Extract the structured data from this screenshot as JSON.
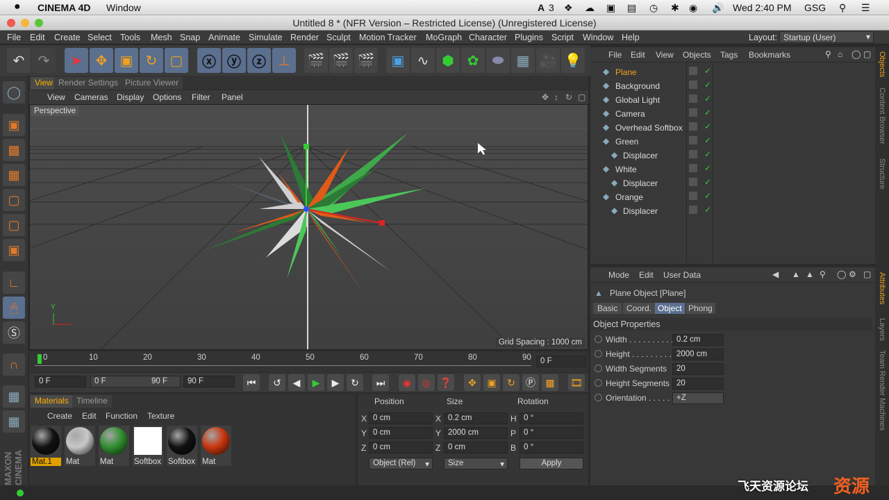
{
  "macbar": {
    "apple": "",
    "app": "CINEMA 4D",
    "window_menu": "Window",
    "adobe_count": "3",
    "clock": "Wed 2:40 PM",
    "user": "GSG"
  },
  "window": {
    "title": "Untitled 8 * (NFR Version – Restricted License) (Unregistered License)"
  },
  "menubar": {
    "items": [
      "File",
      "Edit",
      "Create",
      "Select",
      "Tools",
      "Mesh",
      "Snap",
      "Animate",
      "Simulate",
      "Render",
      "Sculpt",
      "Motion Tracker",
      "MoGraph",
      "Character",
      "Plugins",
      "Script",
      "Window",
      "Help"
    ],
    "layout_label": "Layout:",
    "layout_value": "Startup (User)"
  },
  "viewport": {
    "tabs": [
      "View",
      "Render Settings",
      "Picture Viewer"
    ],
    "menu": [
      "View",
      "Cameras",
      "Display",
      "Options",
      "Filter",
      "Panel"
    ],
    "label": "Perspective",
    "grid_spacing": "Grid Spacing : 1000 cm",
    "axis_y": "Y"
  },
  "timeline": {
    "ticks": [
      "0",
      "10",
      "20",
      "30",
      "40",
      "50",
      "60",
      "70",
      "80",
      "90"
    ],
    "current_frame": "0 F",
    "start": "0 F",
    "range_start": "0 F",
    "range_end": "90 F",
    "end": "90 F"
  },
  "materials": {
    "tabs": [
      "Materials",
      "Timeline"
    ],
    "menu": [
      "Create",
      "Edit",
      "Function",
      "Texture"
    ],
    "items": [
      {
        "name": "Mat.1",
        "color": "#111111"
      },
      {
        "name": "Mat",
        "color": "#c8c8c8"
      },
      {
        "name": "Mat",
        "color": "#2f8f2f"
      },
      {
        "name": "Softbox",
        "color": "#ffffff"
      },
      {
        "name": "Softbox",
        "color": "#111111"
      },
      {
        "name": "Mat",
        "color": "#c8360f"
      }
    ]
  },
  "coords": {
    "headers": [
      "Position",
      "Size",
      "Rotation"
    ],
    "rows": [
      {
        "axis": "X",
        "pos": "0 cm",
        "size_axis": "X",
        "size": "0.2 cm",
        "rot_axis": "H",
        "rot": "0 °"
      },
      {
        "axis": "Y",
        "pos": "0 cm",
        "size_axis": "Y",
        "size": "2000 cm",
        "rot_axis": "P",
        "rot": "0 °"
      },
      {
        "axis": "Z",
        "pos": "0 cm",
        "size_axis": "Z",
        "size": "0 cm",
        "rot_axis": "B",
        "rot": "0 °"
      }
    ],
    "mode": "Object (Rel)",
    "size_mode": "Size",
    "apply": "Apply"
  },
  "objects": {
    "menu": [
      "File",
      "Edit",
      "View",
      "Objects",
      "Tags",
      "Bookmarks"
    ],
    "items": [
      {
        "name": "Plane",
        "indent": 0,
        "selected": true
      },
      {
        "name": "Background",
        "indent": 0
      },
      {
        "name": "Global Light",
        "indent": 0
      },
      {
        "name": "Camera",
        "indent": 0
      },
      {
        "name": "Overhead Softbox",
        "indent": 0
      },
      {
        "name": "Green",
        "indent": 0
      },
      {
        "name": "Displacer",
        "indent": 1
      },
      {
        "name": "White",
        "indent": 0
      },
      {
        "name": "Displacer",
        "indent": 1
      },
      {
        "name": "Orange",
        "indent": 0
      },
      {
        "name": "Displacer",
        "indent": 1
      }
    ]
  },
  "attributes": {
    "menu": [
      "Mode",
      "Edit",
      "User Data"
    ],
    "object_title": "Plane Object [Plane]",
    "tabs": [
      "Basic",
      "Coord.",
      "Object",
      "Phong"
    ],
    "section": "Object Properties",
    "props": [
      {
        "label": "Width . . . . . . . . . .",
        "value": "0.2 cm"
      },
      {
        "label": "Height . . . . . . . . .",
        "value": "2000 cm"
      },
      {
        "label": "Width Segments",
        "value": "20"
      },
      {
        "label": "Height Segments",
        "value": "20"
      },
      {
        "label": "Orientation . . . . .",
        "value": "+Z"
      }
    ]
  },
  "sidetabs": [
    "Objects",
    "Content Browser",
    "Structure",
    "Attributes",
    "Layers",
    "Team Render Machines"
  ],
  "watermark": {
    "text": "飞天资源论坛",
    "logo": "资源"
  }
}
